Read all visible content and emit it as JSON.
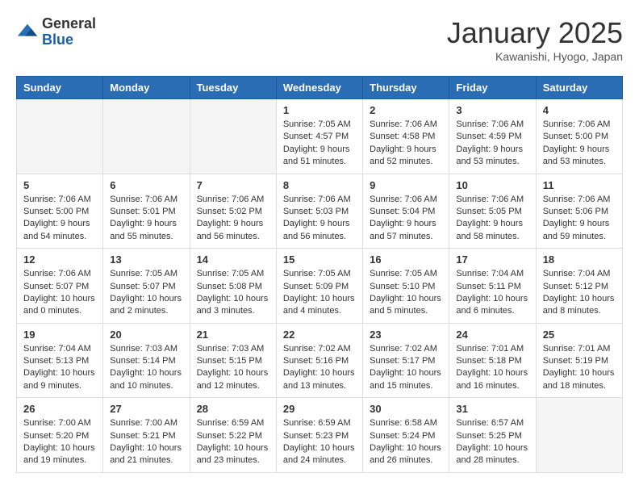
{
  "header": {
    "logo_general": "General",
    "logo_blue": "Blue",
    "month_title": "January 2025",
    "location": "Kawanishi, Hyogo, Japan"
  },
  "weekdays": [
    "Sunday",
    "Monday",
    "Tuesday",
    "Wednesday",
    "Thursday",
    "Friday",
    "Saturday"
  ],
  "weeks": [
    [
      {
        "day": "",
        "info": ""
      },
      {
        "day": "",
        "info": ""
      },
      {
        "day": "",
        "info": ""
      },
      {
        "day": "1",
        "info": "Sunrise: 7:05 AM\nSunset: 4:57 PM\nDaylight: 9 hours and 51 minutes."
      },
      {
        "day": "2",
        "info": "Sunrise: 7:06 AM\nSunset: 4:58 PM\nDaylight: 9 hours and 52 minutes."
      },
      {
        "day": "3",
        "info": "Sunrise: 7:06 AM\nSunset: 4:59 PM\nDaylight: 9 hours and 53 minutes."
      },
      {
        "day": "4",
        "info": "Sunrise: 7:06 AM\nSunset: 5:00 PM\nDaylight: 9 hours and 53 minutes."
      }
    ],
    [
      {
        "day": "5",
        "info": "Sunrise: 7:06 AM\nSunset: 5:00 PM\nDaylight: 9 hours and 54 minutes."
      },
      {
        "day": "6",
        "info": "Sunrise: 7:06 AM\nSunset: 5:01 PM\nDaylight: 9 hours and 55 minutes."
      },
      {
        "day": "7",
        "info": "Sunrise: 7:06 AM\nSunset: 5:02 PM\nDaylight: 9 hours and 56 minutes."
      },
      {
        "day": "8",
        "info": "Sunrise: 7:06 AM\nSunset: 5:03 PM\nDaylight: 9 hours and 56 minutes."
      },
      {
        "day": "9",
        "info": "Sunrise: 7:06 AM\nSunset: 5:04 PM\nDaylight: 9 hours and 57 minutes."
      },
      {
        "day": "10",
        "info": "Sunrise: 7:06 AM\nSunset: 5:05 PM\nDaylight: 9 hours and 58 minutes."
      },
      {
        "day": "11",
        "info": "Sunrise: 7:06 AM\nSunset: 5:06 PM\nDaylight: 9 hours and 59 minutes."
      }
    ],
    [
      {
        "day": "12",
        "info": "Sunrise: 7:06 AM\nSunset: 5:07 PM\nDaylight: 10 hours and 0 minutes."
      },
      {
        "day": "13",
        "info": "Sunrise: 7:05 AM\nSunset: 5:07 PM\nDaylight: 10 hours and 2 minutes."
      },
      {
        "day": "14",
        "info": "Sunrise: 7:05 AM\nSunset: 5:08 PM\nDaylight: 10 hours and 3 minutes."
      },
      {
        "day": "15",
        "info": "Sunrise: 7:05 AM\nSunset: 5:09 PM\nDaylight: 10 hours and 4 minutes."
      },
      {
        "day": "16",
        "info": "Sunrise: 7:05 AM\nSunset: 5:10 PM\nDaylight: 10 hours and 5 minutes."
      },
      {
        "day": "17",
        "info": "Sunrise: 7:04 AM\nSunset: 5:11 PM\nDaylight: 10 hours and 6 minutes."
      },
      {
        "day": "18",
        "info": "Sunrise: 7:04 AM\nSunset: 5:12 PM\nDaylight: 10 hours and 8 minutes."
      }
    ],
    [
      {
        "day": "19",
        "info": "Sunrise: 7:04 AM\nSunset: 5:13 PM\nDaylight: 10 hours and 9 minutes."
      },
      {
        "day": "20",
        "info": "Sunrise: 7:03 AM\nSunset: 5:14 PM\nDaylight: 10 hours and 10 minutes."
      },
      {
        "day": "21",
        "info": "Sunrise: 7:03 AM\nSunset: 5:15 PM\nDaylight: 10 hours and 12 minutes."
      },
      {
        "day": "22",
        "info": "Sunrise: 7:02 AM\nSunset: 5:16 PM\nDaylight: 10 hours and 13 minutes."
      },
      {
        "day": "23",
        "info": "Sunrise: 7:02 AM\nSunset: 5:17 PM\nDaylight: 10 hours and 15 minutes."
      },
      {
        "day": "24",
        "info": "Sunrise: 7:01 AM\nSunset: 5:18 PM\nDaylight: 10 hours and 16 minutes."
      },
      {
        "day": "25",
        "info": "Sunrise: 7:01 AM\nSunset: 5:19 PM\nDaylight: 10 hours and 18 minutes."
      }
    ],
    [
      {
        "day": "26",
        "info": "Sunrise: 7:00 AM\nSunset: 5:20 PM\nDaylight: 10 hours and 19 minutes."
      },
      {
        "day": "27",
        "info": "Sunrise: 7:00 AM\nSunset: 5:21 PM\nDaylight: 10 hours and 21 minutes."
      },
      {
        "day": "28",
        "info": "Sunrise: 6:59 AM\nSunset: 5:22 PM\nDaylight: 10 hours and 23 minutes."
      },
      {
        "day": "29",
        "info": "Sunrise: 6:59 AM\nSunset: 5:23 PM\nDaylight: 10 hours and 24 minutes."
      },
      {
        "day": "30",
        "info": "Sunrise: 6:58 AM\nSunset: 5:24 PM\nDaylight: 10 hours and 26 minutes."
      },
      {
        "day": "31",
        "info": "Sunrise: 6:57 AM\nSunset: 5:25 PM\nDaylight: 10 hours and 28 minutes."
      },
      {
        "day": "",
        "info": ""
      }
    ]
  ]
}
